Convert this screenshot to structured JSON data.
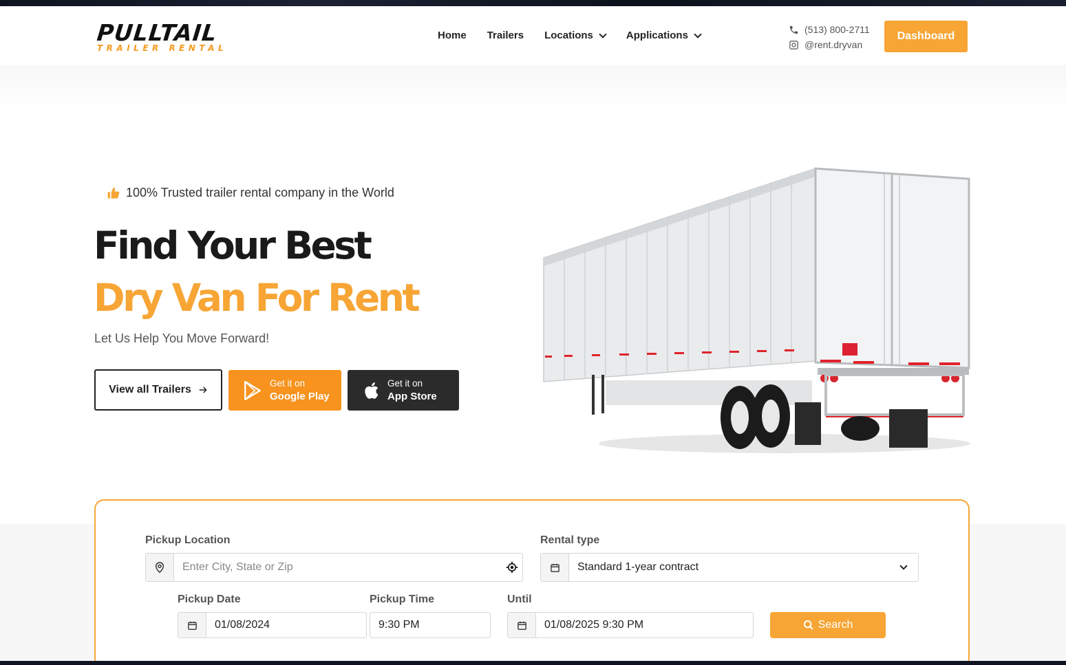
{
  "brand": {
    "name": "PULLTAIL",
    "subtitle": "TRAILER RENTAL",
    "accent_color": "#f7a535"
  },
  "nav": {
    "home": "Home",
    "trailers": "Trailers",
    "locations": "Locations",
    "applications": "Applications"
  },
  "contact": {
    "phone": "(513) 800-2711",
    "instagram": "@rent.dryvan"
  },
  "header": {
    "dashboard_label": "Dashboard"
  },
  "hero": {
    "trusted": "100% Trusted trailer rental company in the World",
    "headline_1": "Find Your Best",
    "headline_2": "Dry Van For Rent",
    "tagline": "Let Us Help You Move Forward!",
    "view_all_label": "View all Trailers",
    "google_play_line1": "Get it on",
    "google_play_line2": "Google Play",
    "app_store_line1": "Get it on",
    "app_store_line2": "App Store"
  },
  "search": {
    "pickup_location_label": "Pickup Location",
    "pickup_location_placeholder": "Enter City, State or Zip",
    "rental_type_label": "Rental type",
    "rental_type_value": "Standard 1-year contract",
    "pickup_date_label": "Pickup Date",
    "pickup_date_value": "01/08/2024",
    "pickup_time_label": "Pickup Time",
    "pickup_time_value": "9:30 PM",
    "until_label": "Until",
    "until_value": "01/08/2025 9:30 PM",
    "search_label": "Search"
  }
}
